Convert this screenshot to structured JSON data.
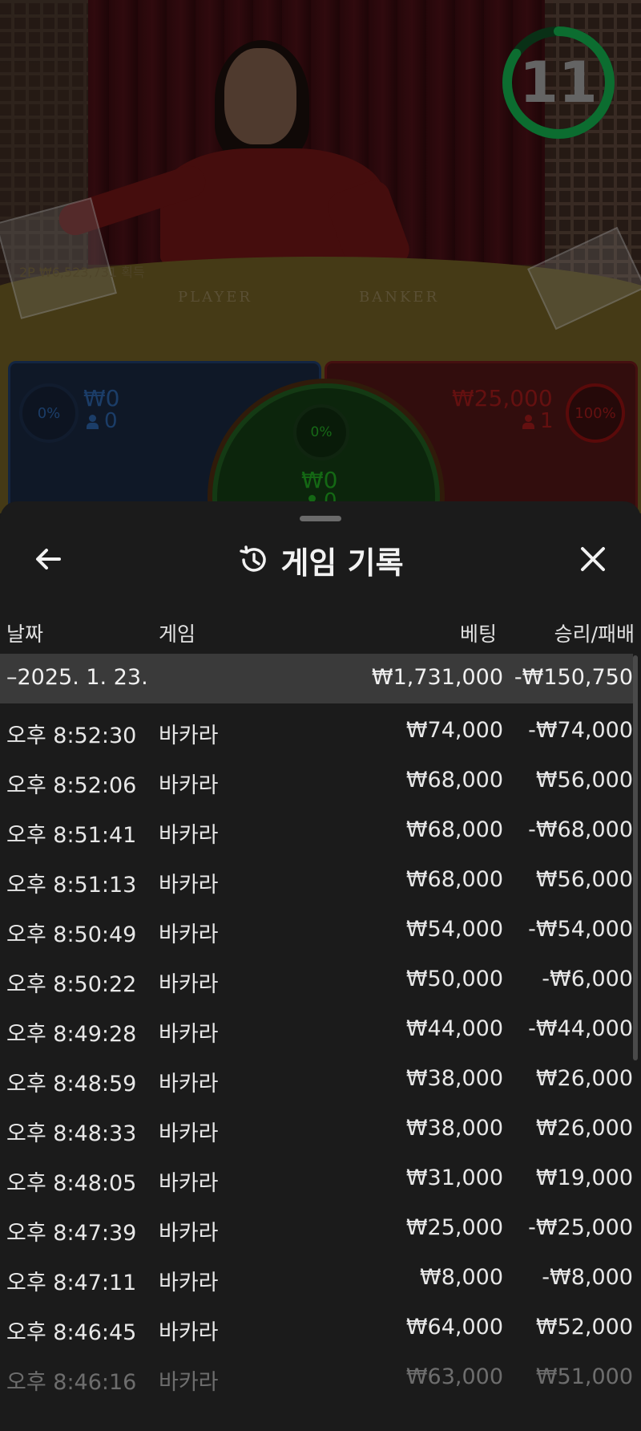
{
  "game": {
    "timer": "11",
    "table_player": "PLAYER",
    "table_banker": "BANKER",
    "faint_win_text": "2P ₩6,523,731 획득",
    "player": {
      "percent": "0%",
      "amount": "₩0",
      "count": "0"
    },
    "banker": {
      "percent": "100%",
      "amount": "₩25,000",
      "count": "1"
    },
    "tie": {
      "percent": "0%",
      "amount": "₩0",
      "count": "0"
    },
    "colors": {
      "player": "#1e3a66",
      "banker": "#8a1010",
      "tie": "#1f5a1f",
      "timer": "#13a84a"
    }
  },
  "history": {
    "title": "게임 기록",
    "columns": {
      "date": "날짜",
      "game": "게임",
      "bet": "베팅",
      "result": "승리/패배"
    },
    "date_group": {
      "date": "–2025. 1. 23.",
      "bet_total": "₩1,731,000",
      "result_total": "-₩150,750"
    },
    "rows": [
      {
        "time": "오후 8:52:30",
        "game": "바카라",
        "bet": "₩74,000",
        "result": "-₩74,000"
      },
      {
        "time": "오후 8:52:06",
        "game": "바카라",
        "bet": "₩68,000",
        "result": "₩56,000"
      },
      {
        "time": "오후 8:51:41",
        "game": "바카라",
        "bet": "₩68,000",
        "result": "-₩68,000"
      },
      {
        "time": "오후 8:51:13",
        "game": "바카라",
        "bet": "₩68,000",
        "result": "₩56,000"
      },
      {
        "time": "오후 8:50:49",
        "game": "바카라",
        "bet": "₩54,000",
        "result": "-₩54,000"
      },
      {
        "time": "오후 8:50:22",
        "game": "바카라",
        "bet": "₩50,000",
        "result": "-₩6,000"
      },
      {
        "time": "오후 8:49:28",
        "game": "바카라",
        "bet": "₩44,000",
        "result": "-₩44,000"
      },
      {
        "time": "오후 8:48:59",
        "game": "바카라",
        "bet": "₩38,000",
        "result": "₩26,000"
      },
      {
        "time": "오후 8:48:33",
        "game": "바카라",
        "bet": "₩38,000",
        "result": "₩26,000"
      },
      {
        "time": "오후 8:48:05",
        "game": "바카라",
        "bet": "₩31,000",
        "result": "₩19,000"
      },
      {
        "time": "오후 8:47:39",
        "game": "바카라",
        "bet": "₩25,000",
        "result": "-₩25,000"
      },
      {
        "time": "오후 8:47:11",
        "game": "바카라",
        "bet": "₩8,000",
        "result": "-₩8,000"
      },
      {
        "time": "오후 8:46:45",
        "game": "바카라",
        "bet": "₩64,000",
        "result": "₩52,000"
      },
      {
        "time": "오후 8:46:16",
        "game": "바카라",
        "bet": "₩63,000",
        "result": "₩51,000"
      }
    ]
  },
  "icons": {
    "back": "arrow-left-icon",
    "close": "close-icon",
    "history": "history-icon"
  }
}
